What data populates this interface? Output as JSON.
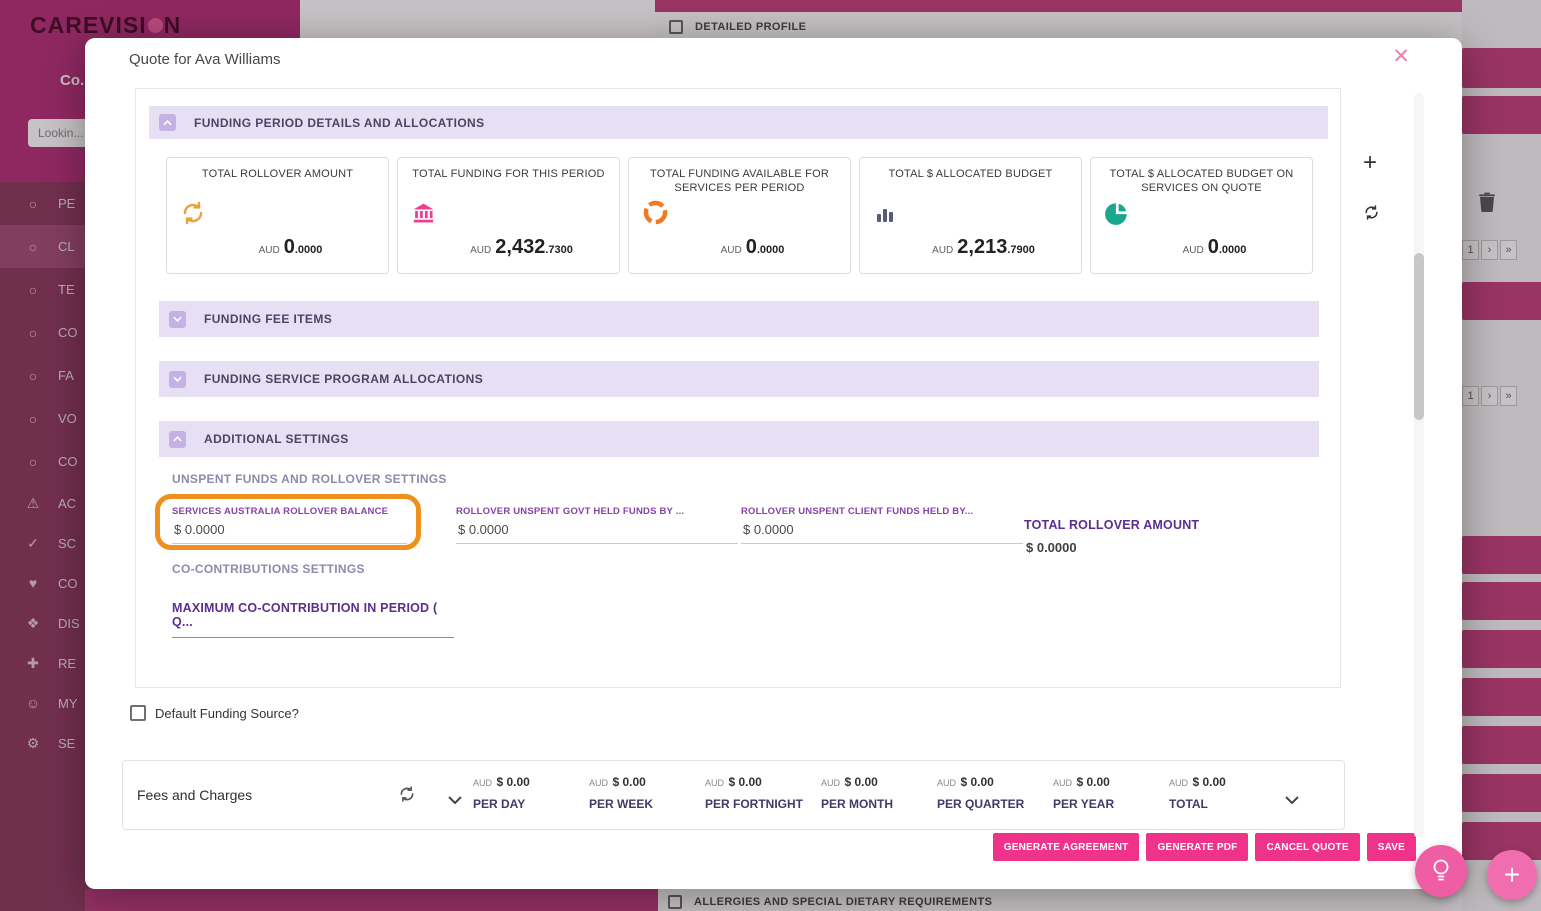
{
  "colors": {
    "brand_magenta": "#b5327a",
    "row_pink": "#c2427e",
    "accent_pink": "#f0338a",
    "lavender": "#e7e0f5",
    "purple_strong": "#5b2e90",
    "purple_label": "#8742a8",
    "muted_purple": "#9189ac",
    "orange_highlight": "#ef8f1d",
    "icon_yellow": "#e8a33d",
    "icon_pink": "#ee3d8f",
    "icon_orange": "#f07921",
    "icon_slate": "#5a5a78",
    "icon_teal": "#19a78e"
  },
  "background": {
    "brand_left": "CAREVISI",
    "brand_right": "N",
    "header_text": "Co...",
    "search_value": "Lookin...",
    "sidebar_items": [
      {
        "label": "PE"
      },
      {
        "label": "CL"
      },
      {
        "label": "TE"
      },
      {
        "label": "CO"
      },
      {
        "label": "FA"
      },
      {
        "label": "VO"
      },
      {
        "label": "CO"
      },
      {
        "label": "AC"
      },
      {
        "label": "SC"
      },
      {
        "label": "CO"
      },
      {
        "label": "DIS"
      },
      {
        "label": "RE"
      },
      {
        "label": "MY"
      },
      {
        "label": "SE"
      }
    ],
    "detailed_profile_label": "DETAILED PROFILE",
    "allergies_label": "ALLERGIES AND SPECIAL DIETARY REQUIREMENTS",
    "pagination": {
      "page": "1",
      "next": "›",
      "last": "»"
    }
  },
  "modal": {
    "title": "Quote for Ava Williams",
    "close_label": "✕",
    "section_funding_period": "FUNDING PERIOD DETAILS AND ALLOCATIONS",
    "stat_cards": [
      {
        "title": "TOTAL ROLLOVER AMOUNT",
        "currency": "AUD",
        "whole": "0",
        "decimals": ".0000"
      },
      {
        "title": "TOTAL FUNDING FOR THIS PERIOD",
        "currency": "AUD",
        "whole": "2,432",
        "decimals": ".7300"
      },
      {
        "title": "TOTAL FUNDING AVAILABLE FOR SERVICES PER PERIOD",
        "currency": "AUD",
        "whole": "0",
        "decimals": ".0000"
      },
      {
        "title": "TOTAL $ ALLOCATED BUDGET",
        "currency": "AUD",
        "whole": "2,213",
        "decimals": ".7900"
      },
      {
        "title": "TOTAL $ ALLOCATED BUDGET ON SERVICES ON QUOTE",
        "currency": "AUD",
        "whole": "0",
        "decimals": ".0000"
      }
    ],
    "section_fee_items": "FUNDING FEE ITEMS",
    "section_service_program": "FUNDING SERVICE PROGRAM ALLOCATIONS",
    "section_additional": "ADDITIONAL SETTINGS",
    "unspent_heading": "UNSPENT FUNDS AND ROLLOVER SETTINGS",
    "fields": [
      {
        "label": "SERVICES AUSTRALIA ROLLOVER BALANCE",
        "value": "$ 0.0000"
      },
      {
        "label": "ROLLOVER UNSPENT GOVT HELD FUNDS BY ...",
        "value": "$ 0.0000"
      },
      {
        "label": "ROLLOVER UNSPENT CLIENT FUNDS HELD BY...",
        "value": "$ 0.0000"
      }
    ],
    "total_rollover": {
      "label": "TOTAL ROLLOVER AMOUNT",
      "value": "$ 0.0000"
    },
    "cocontrib_heading": "CO-CONTRIBUTIONS SETTINGS",
    "max_cocontrib_label": "MAXIMUM CO-CONTRIBUTION IN PERIOD ( Q...",
    "default_funding_label": "Default Funding Source?",
    "fees": {
      "title": "Fees and Charges",
      "columns": [
        {
          "currency": "AUD",
          "amount": "$ 0.00",
          "period": "PER DAY"
        },
        {
          "currency": "AUD",
          "amount": "$ 0.00",
          "period": "PER WEEK"
        },
        {
          "currency": "AUD",
          "amount": "$ 0.00",
          "period": "PER FORTNIGHT"
        },
        {
          "currency": "AUD",
          "amount": "$ 0.00",
          "period": "PER MONTH"
        },
        {
          "currency": "AUD",
          "amount": "$ 0.00",
          "period": "PER QUARTER"
        },
        {
          "currency": "AUD",
          "amount": "$ 0.00",
          "period": "PER YEAR"
        },
        {
          "currency": "AUD",
          "amount": "$ 0.00",
          "period": "TOTAL"
        }
      ]
    },
    "footer_buttons": [
      {
        "label": "GENERATE AGREEMENT"
      },
      {
        "label": "GENERATE PDF"
      },
      {
        "label": "CANCEL QUOTE"
      },
      {
        "label": "SAVE"
      }
    ]
  }
}
